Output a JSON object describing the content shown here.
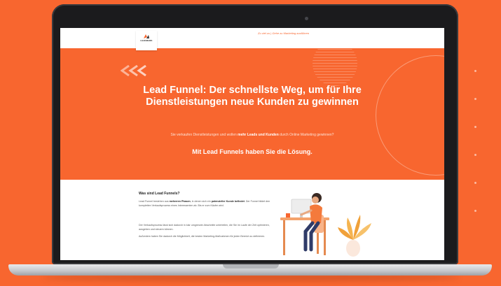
{
  "colors": {
    "brand_orange": "#f8662f",
    "screen_white": "#ffffff",
    "laptop_frame": "#1b1b1d"
  },
  "header": {
    "logo_text": "LEADMARK",
    "top_link": "Zu viel zu | Gehe zu Marketing ausführen"
  },
  "hero": {
    "title": "Lead Funnel: Der schnellste Weg, um für Ihre Dienstleistungen neue Kunden zu gewinnen",
    "subtitle_before": "Sie verkaufen Dienstleistungen und wollen ",
    "subtitle_bold": "mehr Leads und Kunden",
    "subtitle_after": " durch Online Marketing gewinnen?",
    "cta": "Mit Lead Funnels haben Sie die Lösung."
  },
  "content": {
    "heading": "Was sind Lead Funnels?",
    "p1_a": "Lead Funnel bestehen aus ",
    "p1_b": "mehreren Phasen",
    "p1_c": ", in denen sich ein ",
    "p1_d": "potenzieller Kunde befindet",
    "p1_e": ". Der Funnel bildet den kompletten Verkaufsprozess eines Interessenten ab. Bis er zum Käufer wird.",
    "p2": "Der Verkaufsprozess lässt sich dadurch in klar umgrenzte Abschnitte unterteilen, die Sie im Laufe der Zeit optimieren, ausgeben und steuern können.",
    "p3": "Außerdem haben Sie dadurch die Möglichkeit, die besten Marketing-Maßnahmen für jeden Bereich zu definieren."
  },
  "icons": [
    "logo-mark-icon",
    "chevrons-icon",
    "woman-at-desk-illustration",
    "plant-illustration"
  ]
}
